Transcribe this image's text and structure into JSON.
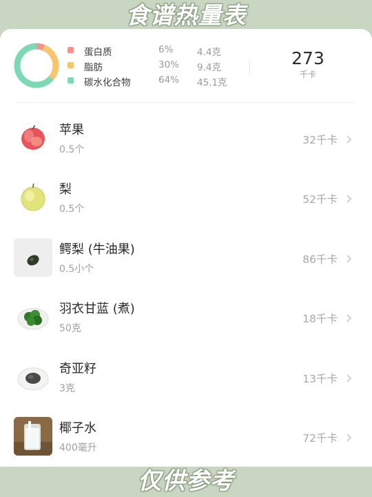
{
  "header_banner": "食谱热量表",
  "footer_banner": "仅供参考",
  "summary": {
    "macros": [
      {
        "name": "蛋白质",
        "percent": "6%",
        "grams": "4.4克",
        "color": "#f2938c",
        "fraction": 0.06
      },
      {
        "name": "脂肪",
        "percent": "30%",
        "grams": "9.4克",
        "color": "#f7c56e",
        "fraction": 0.3
      },
      {
        "name": "碳水化合物",
        "percent": "64%",
        "grams": "45.1克",
        "color": "#7dd9b4",
        "fraction": 0.64
      }
    ],
    "total_value": "273",
    "total_unit": "千卡"
  },
  "foods": [
    {
      "name": "苹果",
      "qty": "0.5个",
      "kcal": "32千卡",
      "icon": "apple-icon"
    },
    {
      "name": "梨",
      "qty": "0.5个",
      "kcal": "52千卡",
      "icon": "pear-icon"
    },
    {
      "name": "鳄梨 (牛油果)",
      "qty": "0.5小个",
      "kcal": "86千卡",
      "icon": "avocado-icon"
    },
    {
      "name": "羽衣甘蓝 (煮)",
      "qty": "50克",
      "kcal": "18千卡",
      "icon": "kale-icon"
    },
    {
      "name": "奇亚籽",
      "qty": "3克",
      "kcal": "13千卡",
      "icon": "chia-seed-icon"
    },
    {
      "name": "椰子水",
      "qty": "400毫升",
      "kcal": "72千卡",
      "icon": "coconut-water-icon"
    }
  ]
}
